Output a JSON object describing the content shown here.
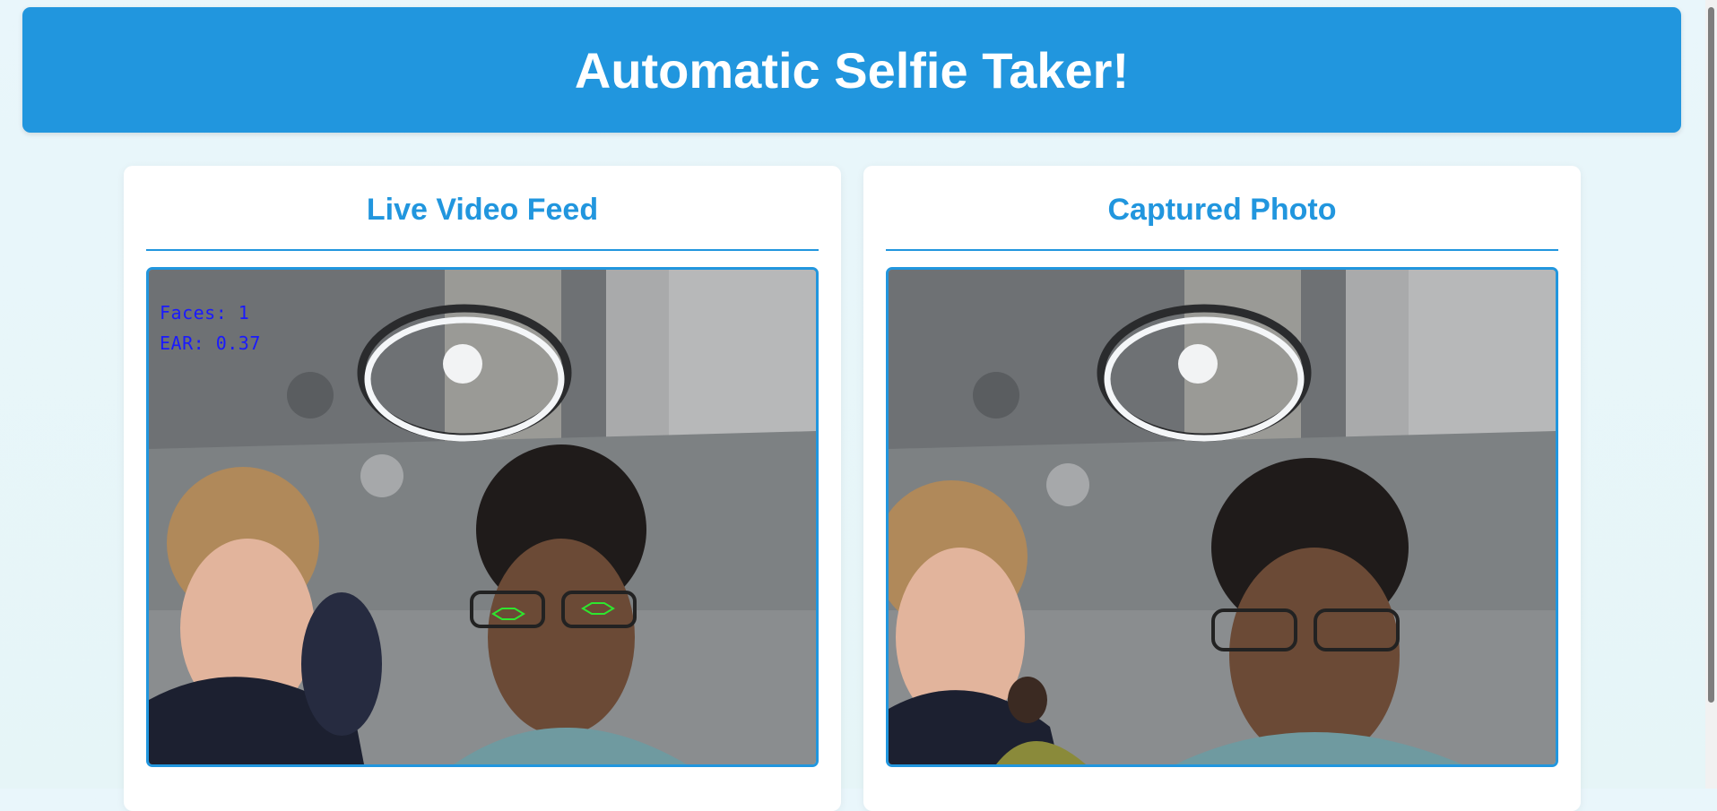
{
  "header": {
    "title": "Automatic Selfie Taker!"
  },
  "panels": {
    "live": {
      "title": "Live Video Feed",
      "overlay": {
        "faces": "Faces: 1",
        "ear": "EAR: 0.37"
      }
    },
    "captured": {
      "title": "Captured Photo"
    }
  },
  "colors": {
    "accent": "#2196de",
    "overlay_text": "#1a1aff",
    "eye_landmarks": "#2ee62e"
  }
}
